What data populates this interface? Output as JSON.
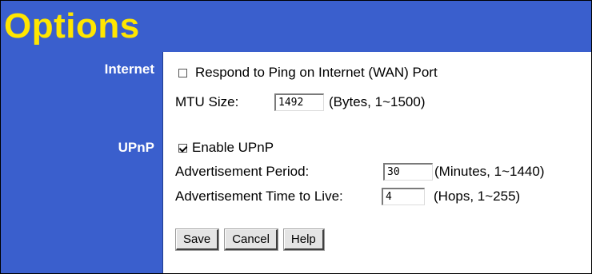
{
  "page": {
    "title": "Options"
  },
  "sections": {
    "internet": {
      "label": "Internet",
      "ping_label": "Respond to Ping on Internet (WAN) Port",
      "ping_checked": false,
      "mtu_label": "MTU Size:",
      "mtu_value": "1492",
      "mtu_hint": "(Bytes, 1~1500)"
    },
    "upnp": {
      "label": "UPnP",
      "enable_label": "Enable UPnP",
      "enable_checked": true,
      "period_label": "Advertisement Period:",
      "period_value": "30",
      "period_hint": "(Minutes, 1~1440)",
      "ttl_label": "Advertisement Time to Live:",
      "ttl_value": "4",
      "ttl_hint": "(Hops, 1~255)"
    }
  },
  "buttons": {
    "save": "Save",
    "cancel": "Cancel",
    "help": "Help"
  },
  "colors": {
    "header_bg": "#3a5fcd",
    "title_text": "#ffe600",
    "label_text": "#ffffff"
  }
}
